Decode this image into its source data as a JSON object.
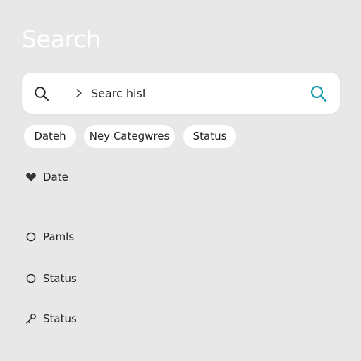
{
  "header": {
    "title": "Search"
  },
  "search": {
    "query": "Searc hisl",
    "accent_color": "#1a9bb0",
    "lead_icon": "search-icon",
    "chevron_icon": "chevron-right-icon",
    "submit_icon": "search-icon"
  },
  "filters": [
    {
      "label": "Dateh"
    },
    {
      "label": "Ney Categwres"
    },
    {
      "label": "Status"
    }
  ],
  "results": [
    {
      "label": "Date",
      "icon": "heart-icon"
    },
    {
      "label": "Pamls",
      "icon": "circle-icon"
    },
    {
      "label": "Status",
      "icon": "circle-icon"
    },
    {
      "label": "Status",
      "icon": "key-icon"
    }
  ]
}
